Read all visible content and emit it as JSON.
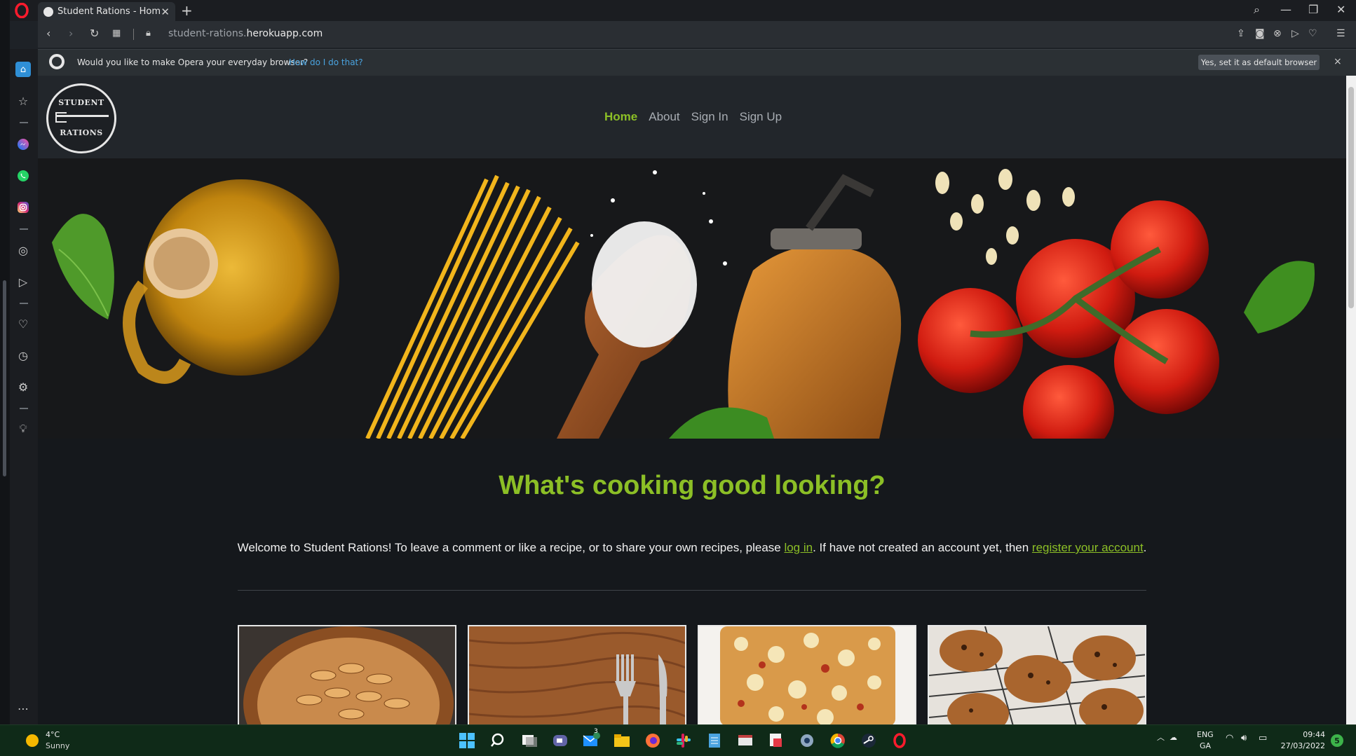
{
  "browser": {
    "tab_title": "Student Rations - Home",
    "tab_close": "✕",
    "new_tab": "+",
    "url_prefix": "student-rations.",
    "url_domain": "herokuapp.com",
    "banner_text": "Would you like to make Opera your everyday browser?",
    "banner_link": "How do I do that?",
    "banner_button": "Yes, set it as default browser",
    "banner_close": "×"
  },
  "site": {
    "logo_top": "STUDENT",
    "logo_bottom": "RATIONS",
    "nav": [
      "Home",
      "About",
      "Sign In",
      "Sign Up"
    ],
    "heading": "What's cooking good looking?",
    "welcome_1": "Welcome to Student Rations! To leave a comment or like a recipe, or to share your own recipes, please ",
    "welcome_link_1": "log in",
    "welcome_2": ". If have not created an account yet, then ",
    "welcome_link_2": "register your account",
    "welcome_3": "."
  },
  "taskbar": {
    "temperature": "4°C",
    "condition": "Sunny",
    "lang_1": "ENG",
    "lang_2": "GA",
    "time": "09:44",
    "date": "27/03/2022",
    "mail_badge": "3",
    "notification_count": "5"
  },
  "colors": {
    "accent": "#8cbf26",
    "page_bg": "#15181c",
    "header_bg": "#22262b"
  }
}
